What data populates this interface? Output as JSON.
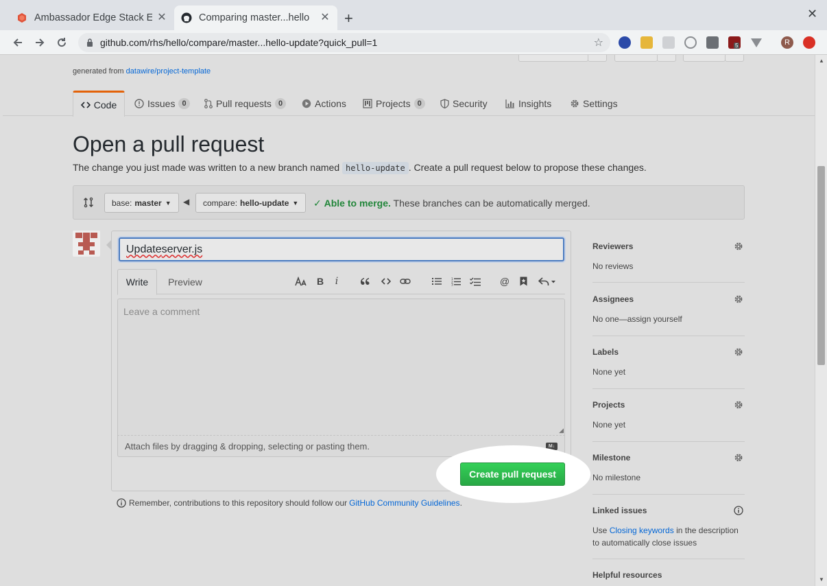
{
  "browser": {
    "tabs": [
      {
        "title": "Ambassador Edge Stack E",
        "active": false
      },
      {
        "title": "Comparing master...hello",
        "active": true
      }
    ],
    "url": "github.com/rhs/hello/compare/master...hello-update?quick_pull=1",
    "extension_badge": "5",
    "profile_initial": "R"
  },
  "repo": {
    "generated_prefix": "generated from",
    "template_link": "datawire/project-template"
  },
  "nav": {
    "code": "Code",
    "issues": "Issues",
    "issues_count": "0",
    "pulls": "Pull requests",
    "pulls_count": "0",
    "actions": "Actions",
    "projects": "Projects",
    "projects_count": "0",
    "security": "Security",
    "insights": "Insights",
    "settings": "Settings"
  },
  "page": {
    "title": "Open a pull request",
    "subtext_before": "The change you just made was written to a new branch named",
    "branch_name": "hello-update",
    "subtext_after": ". Create a pull request below to propose these changes."
  },
  "compare": {
    "base_label": "base:",
    "base_value": "master",
    "compare_label": "compare:",
    "compare_value": "hello-update",
    "merge_status": "Able to merge.",
    "merge_detail": "These branches can be automatically merged."
  },
  "editor": {
    "title_value_first": "Update",
    "title_value_rest": " server.js",
    "tab_write": "Write",
    "tab_preview": "Preview",
    "comment_placeholder": "Leave a comment",
    "attach_text": "Attach files by dragging & dropping, selecting or pasting them.",
    "submit_label": "Create pull request"
  },
  "remember": {
    "text": "Remember, contributions to this repository should follow our",
    "link": "GitHub Community Guidelines",
    "period": "."
  },
  "sidebar": {
    "reviewers": {
      "title": "Reviewers",
      "value": "No reviews"
    },
    "assignees": {
      "title": "Assignees",
      "value": "No one—assign yourself"
    },
    "labels": {
      "title": "Labels",
      "value": "None yet"
    },
    "projects": {
      "title": "Projects",
      "value": "None yet"
    },
    "milestone": {
      "title": "Milestone",
      "value": "No milestone"
    },
    "linked": {
      "title": "Linked issues",
      "prefix": "Use",
      "link": "Closing keywords",
      "suffix": "in the description to automatically close issues"
    },
    "helpful": {
      "title": "Helpful resources"
    }
  },
  "colors": {
    "accent": "#0366d6",
    "success": "#28a745",
    "tab_underline": "#e36209"
  }
}
